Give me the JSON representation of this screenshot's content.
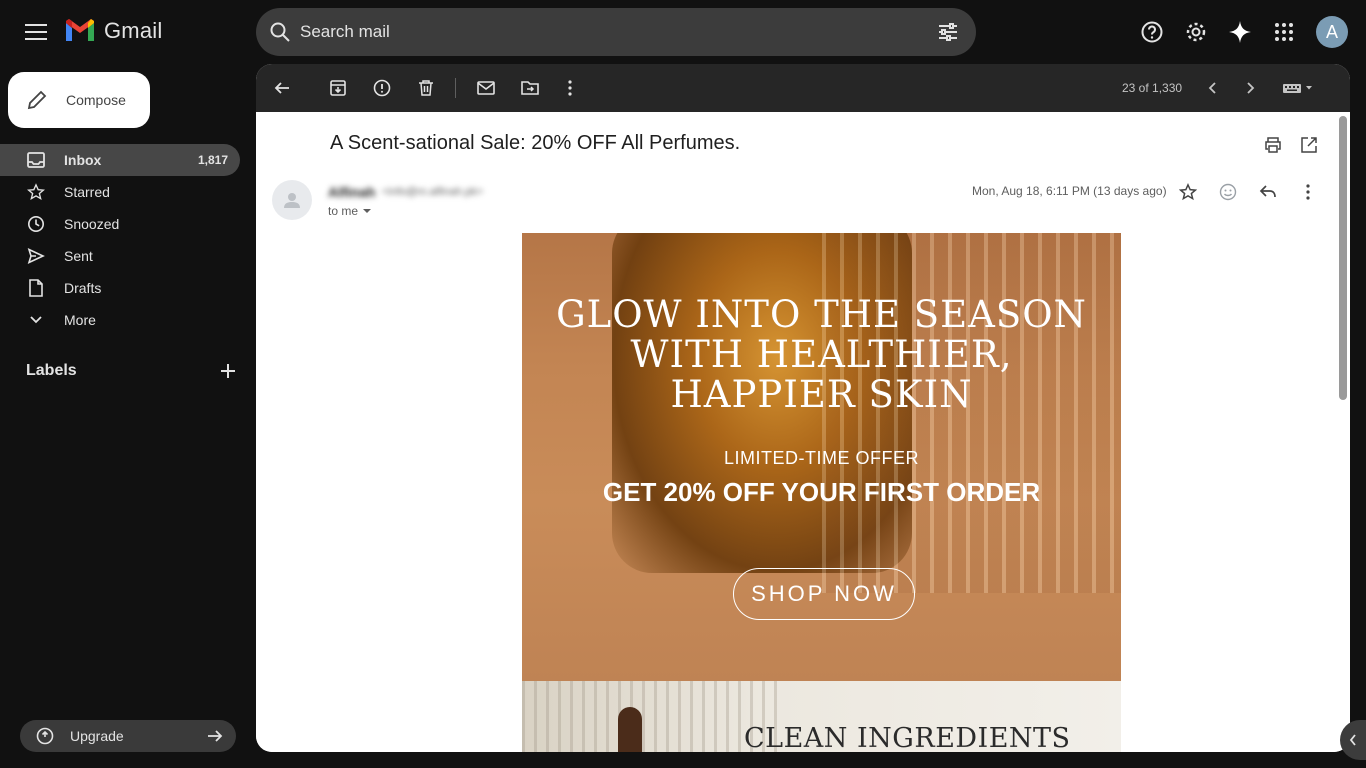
{
  "app": {
    "name": "Gmail"
  },
  "search": {
    "placeholder": "Search mail"
  },
  "account": {
    "avatar_letter": "A"
  },
  "compose": {
    "label": "Compose"
  },
  "nav": [
    {
      "label": "Inbox",
      "count": "1,817",
      "icon": "inbox-icon"
    },
    {
      "label": "Starred",
      "count": "",
      "icon": "star-icon"
    },
    {
      "label": "Snoozed",
      "count": "",
      "icon": "clock-icon"
    },
    {
      "label": "Sent",
      "count": "",
      "icon": "send-icon"
    },
    {
      "label": "Drafts",
      "count": "",
      "icon": "draft-icon"
    },
    {
      "label": "More",
      "count": "",
      "icon": "chevron-down-icon"
    }
  ],
  "labels": {
    "title": "Labels"
  },
  "upgrade": {
    "label": "Upgrade"
  },
  "toolbar": {
    "pager": "23 of 1,330"
  },
  "message": {
    "subject": "A Scent-sational Sale: 20% OFF All Perfumes.",
    "sender_name": "Alfinah",
    "sender_email": "<info@m.alfinah.pk>",
    "to": "to me",
    "date": "Mon, Aug 18, 6:11 PM (13 days ago)"
  },
  "email_body": {
    "headline": [
      "GLOW INTO THE SEASON",
      "WITH HEALTHIER,",
      "HAPPIER SKIN"
    ],
    "offer_small": "LIMITED-TIME OFFER",
    "offer_big": "GET 20% OFF YOUR FIRST ORDER",
    "cta": "SHOP NOW",
    "section2_title": "CLEAN INGREDIENTS"
  },
  "colors": {
    "background": "#111111",
    "panel": "#ffffff",
    "toolbar": "#262626",
    "active_nav": "#474747",
    "hero": "#c38553"
  }
}
